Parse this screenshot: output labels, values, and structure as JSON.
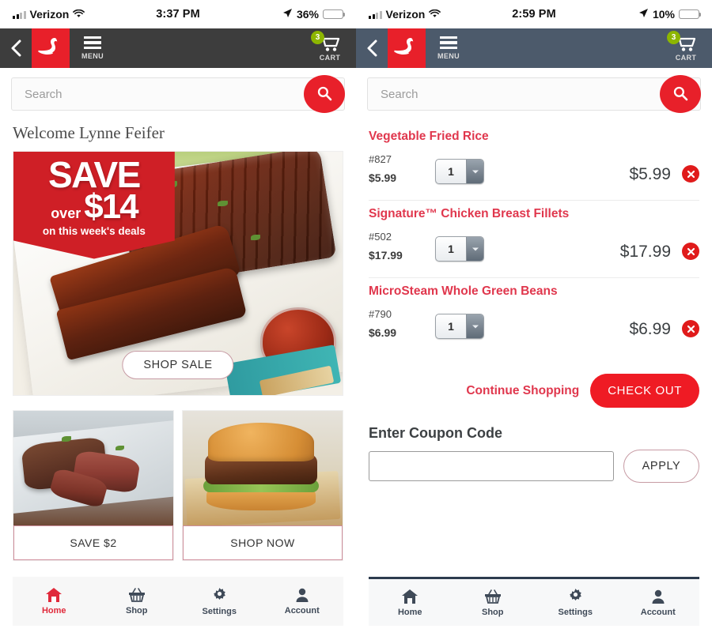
{
  "left_phone": {
    "status_bar": {
      "carrier": "Verizon",
      "time": "3:37 PM",
      "battery_percent": "36%",
      "battery_color": "#f5c518",
      "signal_icon": "cellular-signal-icon",
      "wifi_icon": "wifi-icon",
      "location_icon": "location-arrow-icon",
      "battery_icon": "battery-icon"
    },
    "appbar": {
      "background": "#3d3d3d",
      "back_icon": "back-chevron-icon",
      "logo_icon": "swan-logo-icon",
      "menu_label": "MENU",
      "menu_icon": "hamburger-menu-icon",
      "cart_label": "CART",
      "cart_icon": "shopping-cart-icon",
      "cart_count": "3",
      "cart_badge_color": "#8db600"
    },
    "search": {
      "placeholder": "Search",
      "value": "",
      "button_icon": "search-magnifier-icon",
      "button_color": "#e8202a"
    },
    "welcome": "Welcome Lynne Feifer",
    "hero": {
      "save_word": "SAVE",
      "save_over": "over",
      "save_amount": "$14",
      "save_subtitle": "on this week's deals",
      "cta_label": "SHOP SALE",
      "flag_color": "#cf1f26",
      "image_alt": "barbecue-ribs-photo"
    },
    "cards": [
      {
        "button_label": "SAVE $2",
        "image_alt": "sliced-steak-photo"
      },
      {
        "button_label": "SHOP NOW",
        "image_alt": "burger-photo"
      }
    ],
    "tabs": [
      {
        "label": "Home",
        "icon": "home-icon",
        "active": true
      },
      {
        "label": "Shop",
        "icon": "basket-icon",
        "active": false
      },
      {
        "label": "Settings",
        "icon": "gear-icon",
        "active": false
      },
      {
        "label": "Account",
        "icon": "person-icon",
        "active": false
      }
    ]
  },
  "right_phone": {
    "status_bar": {
      "carrier": "Verizon",
      "time": "2:59 PM",
      "battery_percent": "10%",
      "battery_color": "#e8202a",
      "signal_icon": "cellular-signal-icon",
      "wifi_icon": "wifi-icon",
      "location_icon": "location-arrow-icon",
      "battery_icon": "battery-icon"
    },
    "appbar": {
      "background": "#4c5a6b",
      "back_icon": "back-chevron-icon",
      "logo_icon": "swan-logo-icon",
      "menu_label": "MENU",
      "menu_icon": "hamburger-menu-icon",
      "cart_label": "CART",
      "cart_icon": "shopping-cart-icon",
      "cart_count": "3",
      "cart_badge_color": "#8db600"
    },
    "search": {
      "placeholder": "Search",
      "value": "",
      "button_icon": "search-magnifier-icon",
      "button_color": "#e8202a"
    },
    "cart_items": [
      {
        "name": "Vegetable Fried Rice",
        "sku": "#827",
        "unit_price": "$5.99",
        "quantity": "1",
        "line_total": "$5.99",
        "remove_icon": "remove-circle-x-icon"
      },
      {
        "name": "Signature™ Chicken Breast Fillets",
        "sku": "#502",
        "unit_price": "$17.99",
        "quantity": "1",
        "line_total": "$17.99",
        "remove_icon": "remove-circle-x-icon"
      },
      {
        "name": "MicroSteam Whole Green Beans",
        "sku": "#790",
        "unit_price": "$6.99",
        "quantity": "1",
        "line_total": "$6.99",
        "remove_icon": "remove-circle-x-icon"
      }
    ],
    "actions": {
      "continue_label": "Continue Shopping",
      "checkout_label": "CHECK OUT",
      "checkout_color": "#ef1b24"
    },
    "coupon": {
      "heading": "Enter Coupon Code",
      "value": "",
      "placeholder": "",
      "apply_label": "APPLY"
    },
    "tabs": [
      {
        "label": "Home",
        "icon": "home-icon",
        "active": false
      },
      {
        "label": "Shop",
        "icon": "basket-icon",
        "active": false
      },
      {
        "label": "Settings",
        "icon": "gear-icon",
        "active": false
      },
      {
        "label": "Account",
        "icon": "person-icon",
        "active": false
      }
    ]
  }
}
